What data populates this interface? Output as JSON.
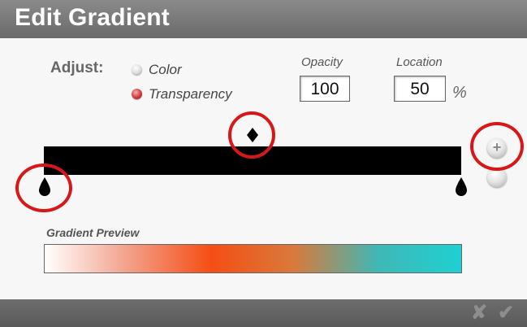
{
  "dialog": {
    "title": "Edit Gradient"
  },
  "adjust": {
    "label": "Adjust:",
    "options": [
      {
        "label": "Color",
        "selected": false
      },
      {
        "label": "Transparency",
        "selected": true
      }
    ]
  },
  "opacity": {
    "label": "Opacity",
    "value": "100"
  },
  "location": {
    "label": "Location",
    "value": "50",
    "unit": "%"
  },
  "gradient_bar": {
    "color": "#000000",
    "stops": [
      {
        "type": "color",
        "position_percent": 0
      },
      {
        "type": "color",
        "position_percent": 100
      },
      {
        "type": "midpoint",
        "position_percent": 50
      }
    ],
    "add_stop_icon": "plus-icon"
  },
  "preview": {
    "label": "Gradient Preview",
    "colors": [
      "#ffffff",
      "#f3a08a",
      "#f54e14",
      "#d87a3c",
      "#3fb8b6",
      "#1fd0d2"
    ]
  },
  "footer": {
    "cancel_icon": "close-icon",
    "confirm_icon": "checkmark-icon",
    "cancel_glyph": "✘",
    "confirm_glyph": "✔"
  },
  "highlight_color": "#d81818"
}
